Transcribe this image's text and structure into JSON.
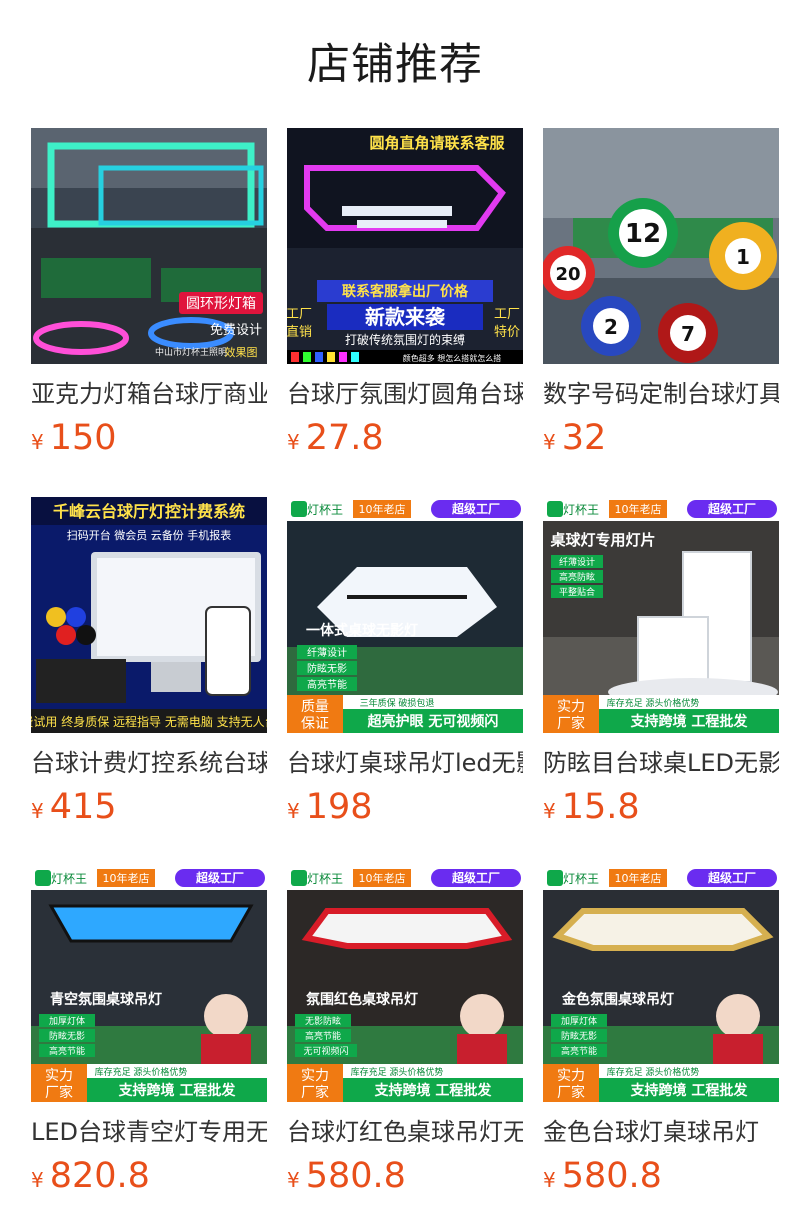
{
  "header": {
    "title": "店铺推荐"
  },
  "currency": "¥",
  "products": [
    {
      "name": "亚克力灯箱台球厅商业",
      "price": "150",
      "image_text": {
        "badge": "圆环形灯箱",
        "promo": "免费设计",
        "shop": "中山市灯杯王照明",
        "extra": "效果图"
      }
    },
    {
      "name": "台球厅氛围灯圆角台球",
      "price": "27.8",
      "image_text": {
        "top": "圆角直角请联系客服",
        "mid": "联系客服拿出厂价格",
        "headline": "新款来袭",
        "sub": "打破传统氛围灯的束缚",
        "left1": "工厂",
        "left2": "直销",
        "right1": "工厂",
        "right2": "特价",
        "footer": "颜色超多 想怎么搭就怎么搭"
      }
    },
    {
      "name": "数字号码定制台球灯具",
      "price": "32",
      "image_text": {
        "n1": "20",
        "n2": "12",
        "n3": "1",
        "n4": "2",
        "n5": "7"
      }
    },
    {
      "name": "台球计费灯控系统台球",
      "price": "415",
      "image_text": {
        "top": "千峰云台球厅灯控计费系统",
        "features": "扫码开台  微会员  云备份  手机报表",
        "footer": "免费试用 终身质保 远程指导 无需电脑 支持无人台助"
      }
    },
    {
      "name": "台球灯桌球吊灯led无影",
      "price": "198",
      "image_text": {
        "brand": "灯杯王",
        "years": "10年老店",
        "factory": "超级工厂",
        "headline": "一体式桌球无影灯",
        "f1": "纤薄设计",
        "f2": "防眩无影",
        "f3": "高亮节能",
        "q1": "质量",
        "q2": "保证",
        "guarantee": "三年质保  破损包退",
        "banner": "超亮护眼 无可视频闪"
      }
    },
    {
      "name": "防眩目台球桌LED无影灯",
      "price": "15.8",
      "image_text": {
        "brand": "灯杯王",
        "years": "10年老店",
        "factory": "超级工厂",
        "headline": "桌球灯专用灯片",
        "f1": "纤薄设计",
        "f2": "高亮防眩",
        "f3": "平整贴合",
        "s1": "实力",
        "s2": "厂家",
        "stock": "库存充足  源头价格优势",
        "banner": "支持跨境 工程批发"
      }
    },
    {
      "name": "LED台球青空灯专用无影",
      "price": "820.8",
      "image_text": {
        "brand": "灯杯王",
        "years": "10年老店",
        "factory": "超级工厂",
        "headline": "青空氛围桌球吊灯",
        "f1": "加厚灯体",
        "f2": "防眩无影",
        "f3": "高亮节能",
        "s1": "实力",
        "s2": "厂家",
        "stock": "库存充足  源头价格优势",
        "banner": "支持跨境 工程批发"
      }
    },
    {
      "name": "台球灯红色桌球吊灯无影",
      "price": "580.8",
      "image_text": {
        "brand": "灯杯王",
        "years": "10年老店",
        "factory": "超级工厂",
        "headline": "氛围红色桌球吊灯",
        "f1": "无影防眩",
        "f2": "高亮节能",
        "f3": "无可视频闪",
        "s1": "实力",
        "s2": "厂家",
        "stock": "库存充足  源头价格优势",
        "banner": "支持跨境 工程批发"
      }
    },
    {
      "name": "金色台球灯桌球吊灯",
      "price": "580.8",
      "image_text": {
        "brand": "灯杯王",
        "years": "10年老店",
        "factory": "超级工厂",
        "headline": "金色氛围桌球吊灯",
        "f1": "加厚灯体",
        "f2": "防眩无影",
        "f3": "高亮节能",
        "s1": "实力",
        "s2": "厂家",
        "stock": "库存充足  源头价格优势",
        "banner": "支持跨境 工程批发"
      }
    }
  ],
  "colors": {
    "price": "#e84f1a",
    "title": "#1a1a1a",
    "name": "#333333",
    "purple_badge": "#6a2cf0",
    "green_banner": "#0fa84a",
    "orange_tag": "#f07a12"
  }
}
